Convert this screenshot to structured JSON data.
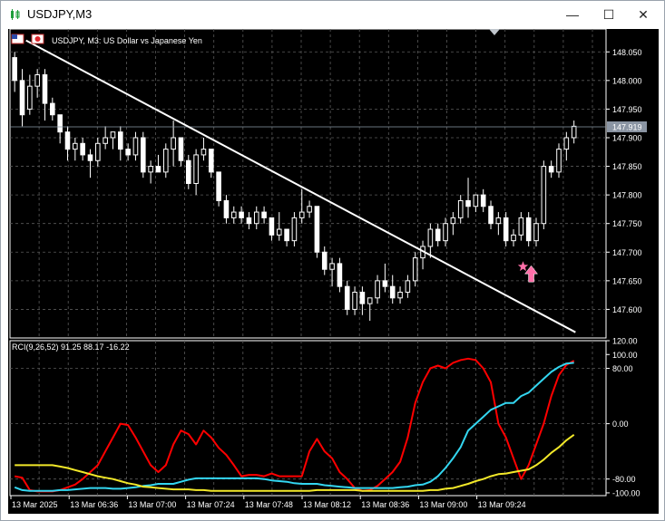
{
  "window": {
    "title": "USDJPY,M3",
    "minimize_glyph": "—",
    "maximize_glyph": "☐",
    "close_glyph": "✕"
  },
  "chart": {
    "header": "USDJPY, M3:  US Dollar vs Japanese Yen",
    "current_price": "147.919",
    "price_ticks": [
      "148.050",
      "148.000",
      "147.950",
      "147.900",
      "147.850",
      "147.800",
      "147.750",
      "147.700",
      "147.650",
      "147.600"
    ],
    "time_labels": [
      "13 Mar 2025",
      "13 Mar 06:36",
      "13 Mar 07:00",
      "13 Mar 07:24",
      "13 Mar 07:48",
      "13 Mar 08:12",
      "13 Mar 08:36",
      "13 Mar 09:00",
      "13 Mar 09:24"
    ],
    "colors": {
      "background": "#000000",
      "grid": "#5a5a5a",
      "bull_candle": "#ffffff",
      "bear_candle": "#ffffff",
      "wick": "#ffffff",
      "trendline": "#ffffff",
      "signal": "#ff6fa8"
    }
  },
  "indicator": {
    "label": "RCI(9,26,52) 91.25 88.17 -16.22",
    "ticks": [
      "120.00",
      "100.00",
      "80.00",
      "0.00",
      "-80.00",
      "-100.00"
    ],
    "series_colors": [
      "#ff0000",
      "#33d6f0",
      "#f2e829"
    ]
  },
  "chart_data": [
    {
      "type": "candlestick",
      "title": "USDJPY, M3:  US Dollar vs Japanese Yen",
      "ylim": [
        147.55,
        148.09
      ],
      "candles": [
        [
          148.04,
          148.05,
          147.98,
          148.0
        ],
        [
          148.0,
          148.02,
          147.92,
          147.94
        ],
        [
          147.95,
          148.01,
          147.94,
          147.99
        ],
        [
          147.99,
          148.02,
          147.97,
          148.01
        ],
        [
          148.01,
          148.02,
          147.93,
          147.96
        ],
        [
          147.96,
          147.97,
          147.93,
          147.94
        ],
        [
          147.94,
          147.94,
          147.89,
          147.91
        ],
        [
          147.91,
          147.92,
          147.86,
          147.88
        ],
        [
          147.88,
          147.9,
          147.86,
          147.89
        ],
        [
          147.89,
          147.9,
          147.86,
          147.87
        ],
        [
          147.87,
          147.88,
          147.83,
          147.86
        ],
        [
          147.86,
          147.9,
          147.85,
          147.89
        ],
        [
          147.89,
          147.92,
          147.88,
          147.9
        ],
        [
          147.9,
          147.91,
          147.88,
          147.91
        ],
        [
          147.91,
          147.92,
          147.86,
          147.88
        ],
        [
          147.88,
          147.89,
          147.86,
          147.87
        ],
        [
          147.87,
          147.91,
          147.86,
          147.9
        ],
        [
          147.9,
          147.91,
          147.83,
          147.84
        ],
        [
          147.84,
          147.86,
          147.82,
          147.85
        ],
        [
          147.85,
          147.87,
          147.84,
          147.84
        ],
        [
          147.84,
          147.89,
          147.83,
          147.88
        ],
        [
          147.88,
          147.93,
          147.85,
          147.9
        ],
        [
          147.9,
          147.9,
          147.85,
          147.86
        ],
        [
          147.86,
          147.87,
          147.81,
          147.82
        ],
        [
          147.82,
          147.88,
          147.8,
          147.87
        ],
        [
          147.87,
          147.9,
          147.86,
          147.88
        ],
        [
          147.88,
          147.88,
          147.83,
          147.84
        ],
        [
          147.84,
          147.84,
          147.78,
          147.79
        ],
        [
          147.79,
          147.8,
          147.75,
          147.76
        ],
        [
          147.76,
          147.78,
          147.75,
          147.77
        ],
        [
          147.77,
          147.78,
          147.75,
          147.76
        ],
        [
          147.76,
          147.77,
          147.74,
          147.75
        ],
        [
          147.75,
          147.78,
          147.74,
          147.77
        ],
        [
          147.77,
          147.78,
          147.75,
          147.76
        ],
        [
          147.76,
          147.76,
          147.72,
          147.73
        ],
        [
          147.73,
          147.77,
          147.72,
          147.74
        ],
        [
          147.74,
          147.74,
          147.71,
          147.72
        ],
        [
          147.72,
          147.77,
          147.71,
          147.76
        ],
        [
          147.76,
          147.81,
          147.75,
          147.77
        ],
        [
          147.77,
          147.79,
          147.76,
          147.78
        ],
        [
          147.78,
          147.78,
          147.69,
          147.7
        ],
        [
          147.7,
          147.71,
          147.66,
          147.67
        ],
        [
          147.67,
          147.69,
          147.64,
          147.68
        ],
        [
          147.68,
          147.69,
          147.63,
          147.64
        ],
        [
          147.64,
          147.65,
          147.59,
          147.6
        ],
        [
          147.6,
          147.64,
          147.59,
          147.63
        ],
        [
          147.63,
          147.64,
          147.59,
          147.61
        ],
        [
          147.61,
          147.62,
          147.58,
          147.62
        ],
        [
          147.62,
          147.66,
          147.61,
          147.65
        ],
        [
          147.65,
          147.68,
          147.63,
          147.64
        ],
        [
          147.64,
          147.66,
          147.61,
          147.62
        ],
        [
          147.62,
          147.64,
          147.61,
          147.63
        ],
        [
          147.63,
          147.66,
          147.62,
          147.65
        ],
        [
          147.65,
          147.7,
          147.64,
          147.69
        ],
        [
          147.69,
          147.72,
          147.67,
          147.71
        ],
        [
          147.71,
          147.75,
          147.69,
          147.74
        ],
        [
          147.74,
          147.75,
          147.71,
          147.72
        ],
        [
          147.72,
          147.76,
          147.71,
          147.75
        ],
        [
          147.75,
          147.77,
          147.73,
          147.76
        ],
        [
          147.76,
          147.8,
          147.75,
          147.79
        ],
        [
          147.79,
          147.83,
          147.76,
          147.78
        ],
        [
          147.78,
          147.8,
          147.77,
          147.8
        ],
        [
          147.8,
          147.81,
          147.77,
          147.78
        ],
        [
          147.78,
          147.79,
          147.74,
          147.75
        ],
        [
          147.75,
          147.77,
          147.73,
          147.76
        ],
        [
          147.76,
          147.77,
          147.71,
          147.72
        ],
        [
          147.72,
          147.74,
          147.71,
          147.73
        ],
        [
          147.73,
          147.77,
          147.72,
          147.76
        ],
        [
          147.76,
          147.77,
          147.71,
          147.72
        ],
        [
          147.72,
          147.76,
          147.71,
          147.75
        ],
        [
          147.75,
          147.86,
          147.74,
          147.85
        ],
        [
          147.85,
          147.86,
          147.83,
          147.84
        ],
        [
          147.84,
          147.89,
          147.83,
          147.88
        ],
        [
          147.88,
          147.91,
          147.86,
          147.9
        ],
        [
          147.9,
          147.93,
          147.89,
          147.92
        ]
      ],
      "trendline": {
        "from_index": 1.5,
        "from_price": 148.07,
        "to_index": 74.2,
        "to_price": 147.56
      },
      "signals": [
        {
          "type": "buy-arrow",
          "index": 67.5,
          "price": 147.67
        }
      ]
    },
    {
      "type": "line",
      "title": "RCI(9,26,52) 91.25 88.17 -16.22",
      "ylim": [
        -104,
        120
      ],
      "series": [
        {
          "values": [
            -76,
            -78,
            -96,
            -98,
            -98,
            -98,
            -96,
            -92,
            -88,
            -80,
            -70,
            -60,
            -40,
            -20,
            0,
            -2,
            -20,
            -40,
            -60,
            -70,
            -60,
            -30,
            -10,
            -15,
            -30,
            -10,
            -20,
            -35,
            -45,
            -60,
            -76,
            -74,
            -74,
            -76,
            -72,
            -76,
            -76,
            -76,
            -76,
            -40,
            -22,
            -40,
            -50,
            -70,
            -80,
            -93,
            -97,
            -96,
            -90,
            -80,
            -70,
            -55,
            -20,
            30,
            60,
            80,
            84,
            80,
            88,
            92,
            94,
            92,
            80,
            60,
            0,
            -20,
            -50,
            -80,
            -60,
            -30,
            0,
            40,
            70,
            85,
            91
          ]
        },
        {
          "values": [
            -92,
            -96,
            -97,
            -97,
            -97,
            -97,
            -96,
            -96,
            -95,
            -94,
            -93,
            -93,
            -93,
            -94,
            -94,
            -93,
            -92,
            -90,
            -89,
            -87,
            -87,
            -87,
            -84,
            -81,
            -79,
            -79,
            -79,
            -79,
            -79,
            -79,
            -79,
            -79,
            -79,
            -80,
            -82,
            -83,
            -84,
            -86,
            -87,
            -87,
            -87,
            -89,
            -90,
            -91,
            -92,
            -93,
            -93,
            -93,
            -93,
            -93,
            -93,
            -92,
            -91,
            -89,
            -88,
            -84,
            -76,
            -64,
            -50,
            -34,
            -10,
            0,
            10,
            20,
            25,
            30,
            30,
            40,
            45,
            55,
            65,
            75,
            82,
            87,
            88
          ]
        },
        {
          "values": [
            -60,
            -60,
            -60,
            -60,
            -60,
            -60,
            -62,
            -64,
            -67,
            -70,
            -73,
            -76,
            -78,
            -80,
            -83,
            -86,
            -88,
            -91,
            -92,
            -93,
            -94,
            -95,
            -95,
            -95,
            -96,
            -96,
            -97,
            -97,
            -97,
            -97,
            -97,
            -97,
            -97,
            -97,
            -97,
            -97,
            -97,
            -97,
            -97,
            -97,
            -96,
            -96,
            -96,
            -96,
            -96,
            -96,
            -97,
            -97,
            -97,
            -97,
            -97,
            -97,
            -97,
            -97,
            -97,
            -96,
            -96,
            -94,
            -93,
            -90,
            -87,
            -83,
            -80,
            -76,
            -73,
            -72,
            -70,
            -68,
            -66,
            -60,
            -52,
            -42,
            -34,
            -24,
            -16
          ]
        }
      ]
    }
  ]
}
